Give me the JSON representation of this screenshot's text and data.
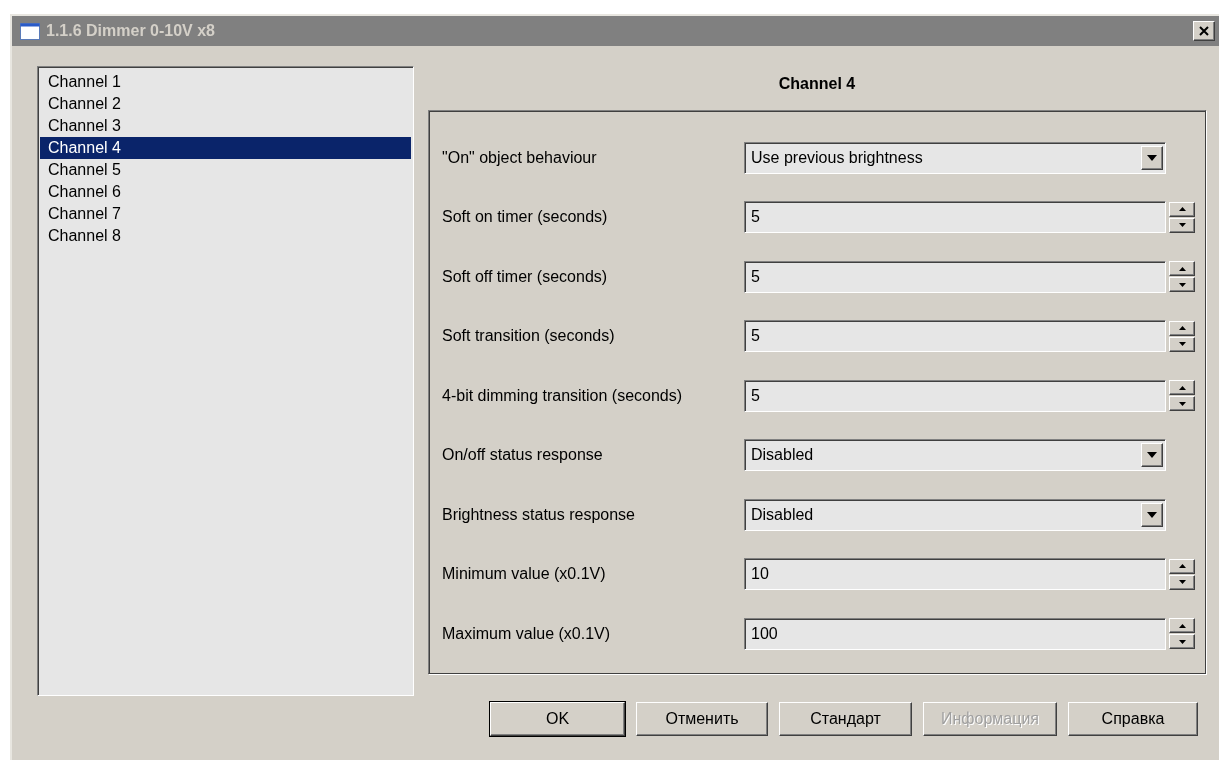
{
  "window": {
    "title": "1.1.6 Dimmer 0-10V x8"
  },
  "channels": [
    {
      "label": "Channel 1",
      "selected": false
    },
    {
      "label": "Channel 2",
      "selected": false
    },
    {
      "label": "Channel 3",
      "selected": false
    },
    {
      "label": "Channel 4",
      "selected": true
    },
    {
      "label": "Channel 5",
      "selected": false
    },
    {
      "label": "Channel 6",
      "selected": false
    },
    {
      "label": "Channel 7",
      "selected": false
    },
    {
      "label": "Channel 8",
      "selected": false
    }
  ],
  "panel": {
    "title": "Channel 4"
  },
  "parameters": [
    {
      "kind": "dropdown",
      "label": "\"On\" object behaviour",
      "value": "Use previous brightness"
    },
    {
      "kind": "spinner",
      "label": "Soft on timer (seconds)",
      "value": "5"
    },
    {
      "kind": "spinner",
      "label": "Soft off timer (seconds)",
      "value": "5"
    },
    {
      "kind": "spinner",
      "label": "Soft transition (seconds)",
      "value": "5"
    },
    {
      "kind": "spinner",
      "label": "4-bit dimming transition (seconds)",
      "value": "5"
    },
    {
      "kind": "dropdown",
      "label": "On/off status response",
      "value": "Disabled"
    },
    {
      "kind": "dropdown",
      "label": "Brightness status response",
      "value": "Disabled"
    },
    {
      "kind": "spinner",
      "label": "Minimum value (x0.1V)",
      "value": "10"
    },
    {
      "kind": "spinner",
      "label": "Maximum value (x0.1V)",
      "value": "100"
    }
  ],
  "buttons": [
    {
      "label": "OK",
      "default": true,
      "disabled": false
    },
    {
      "label": "Отменить",
      "default": false,
      "disabled": false
    },
    {
      "label": "Стандарт",
      "default": false,
      "disabled": false
    },
    {
      "label": "Информация",
      "default": false,
      "disabled": true
    },
    {
      "label": "Справка",
      "default": false,
      "disabled": false
    }
  ]
}
